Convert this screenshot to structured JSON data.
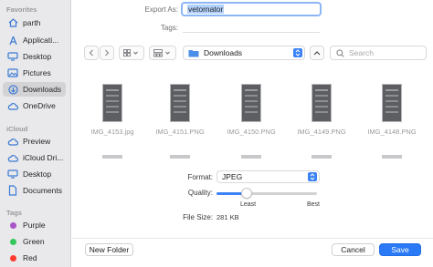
{
  "sidebar": {
    "favorites_header": "Favorites",
    "favorites": [
      {
        "label": "parth",
        "icon": "home-icon"
      },
      {
        "label": "Applicati...",
        "icon": "applications-icon"
      },
      {
        "label": "Desktop",
        "icon": "desktop-icon"
      },
      {
        "label": "Pictures",
        "icon": "pictures-icon"
      },
      {
        "label": "Downloads",
        "icon": "downloads-icon",
        "selected": true
      },
      {
        "label": "OneDrive",
        "icon": "cloud-icon"
      }
    ],
    "icloud_header": "iCloud",
    "icloud": [
      {
        "label": "Preview",
        "icon": "preview-icon"
      },
      {
        "label": "iCloud Dri...",
        "icon": "icloud-icon"
      },
      {
        "label": "Desktop",
        "icon": "desktop-icon"
      },
      {
        "label": "Documents",
        "icon": "document-icon"
      }
    ],
    "tags_header": "Tags",
    "tags": [
      {
        "label": "Purple",
        "color": "#a855c7"
      },
      {
        "label": "Green",
        "color": "#34c759"
      },
      {
        "label": "Red",
        "color": "#ff3b30"
      }
    ]
  },
  "form": {
    "export_as_label": "Export As:",
    "export_as_value": "vetornator",
    "tags_label": "Tags:"
  },
  "toolbar": {
    "back_icon": "chevron-left-icon",
    "forward_icon": "chevron-right-icon",
    "location": "Downloads",
    "search_placeholder": "Search"
  },
  "files": [
    {
      "name": "IMG_4153.jpg"
    },
    {
      "name": "IMG_4151.PNG"
    },
    {
      "name": "IMG_4150.PNG"
    },
    {
      "name": "IMG_4149.PNG"
    },
    {
      "name": "IMG_4148.PNG"
    }
  ],
  "options": {
    "format_label": "Format:",
    "format_value": "JPEG",
    "quality_label": "Quality:",
    "quality_level": 0.3,
    "quality_min_label": "Least",
    "quality_max_label": "Best",
    "file_size_label": "File Size:",
    "file_size_value": "281 KB"
  },
  "buttons": {
    "new_folder": "New Folder",
    "cancel": "Cancel",
    "save": "Save"
  },
  "colors": {
    "accent": "#2a7af5",
    "sidebar_bg": "#e9e8ea",
    "selected_bg": "#d3d2d5"
  }
}
